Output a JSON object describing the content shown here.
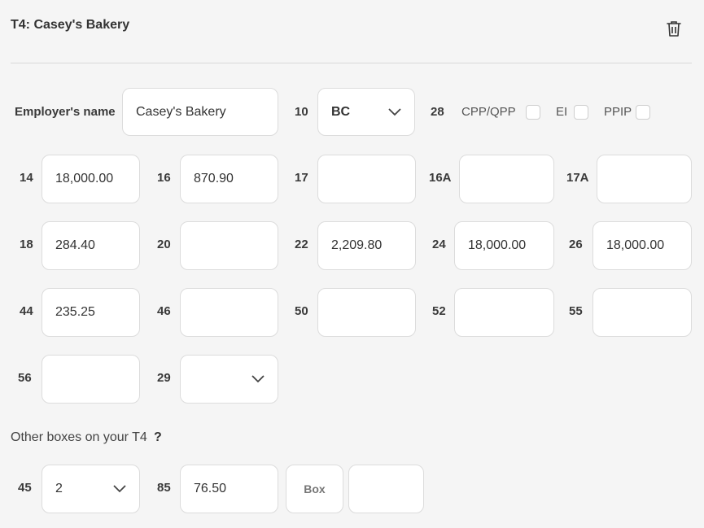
{
  "header": {
    "title": "T4: Casey's Bakery"
  },
  "employer": {
    "label": "Employer's name",
    "value": "Casey's Bakery"
  },
  "box10": {
    "label": "10",
    "value": "BC"
  },
  "box28": {
    "label": "28",
    "options": [
      {
        "label": "CPP/QPP",
        "checked": false
      },
      {
        "label": "EI",
        "checked": false
      },
      {
        "label": "PPIP",
        "checked": false
      }
    ]
  },
  "boxes": {
    "b14": {
      "label": "14",
      "value": "18,000.00"
    },
    "b16": {
      "label": "16",
      "value": "870.90"
    },
    "b17": {
      "label": "17",
      "value": ""
    },
    "b16a": {
      "label": "16A",
      "value": ""
    },
    "b17a": {
      "label": "17A",
      "value": ""
    },
    "b18": {
      "label": "18",
      "value": "284.40"
    },
    "b20": {
      "label": "20",
      "value": ""
    },
    "b22": {
      "label": "22",
      "value": "2,209.80"
    },
    "b24": {
      "label": "24",
      "value": "18,000.00"
    },
    "b26": {
      "label": "26",
      "value": "18,000.00"
    },
    "b44": {
      "label": "44",
      "value": "235.25"
    },
    "b46": {
      "label": "46",
      "value": ""
    },
    "b50": {
      "label": "50",
      "value": ""
    },
    "b52": {
      "label": "52",
      "value": ""
    },
    "b55": {
      "label": "55",
      "value": ""
    },
    "b56": {
      "label": "56",
      "value": ""
    },
    "b29": {
      "label": "29",
      "value": ""
    }
  },
  "other": {
    "label": "Other boxes on your T4",
    "help": "?",
    "box45": {
      "label": "45",
      "value": "2"
    },
    "box85": {
      "label": "85",
      "value": "76.50"
    },
    "box_button": "Box",
    "box_value": ""
  },
  "colors": {
    "background": "#f5f5f5",
    "field_border": "#dcdcdc",
    "text": "#333333"
  }
}
